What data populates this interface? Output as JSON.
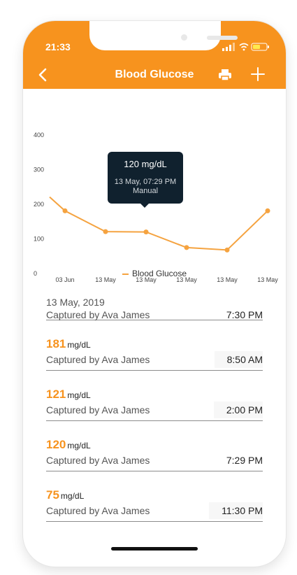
{
  "status_bar": {
    "time": "21:33"
  },
  "nav": {
    "title": "Blood Glucose",
    "icons": [
      "back-chevron-icon",
      "print-icon",
      "plus-icon"
    ]
  },
  "colors": {
    "accent": "#F7931E",
    "line": "#F5A340",
    "tooltip_bg": "#10212e"
  },
  "chart_data": {
    "type": "line",
    "title": "",
    "xlabel": "",
    "ylabel": "",
    "ylim": [
      0,
      400
    ],
    "y_ticks": [
      "0",
      "100",
      "200",
      "300",
      "400"
    ],
    "categories": [
      "03 Jun",
      "13 May",
      "13 May",
      "13 May",
      "13 May",
      "13 May"
    ],
    "series": [
      {
        "name": "Blood Glucose",
        "values": [
          181,
          121,
          120,
          75,
          68,
          181
        ]
      }
    ],
    "legend": "bottom",
    "tooltip": {
      "value": "120 mg/dL",
      "datetime": "13 May, 07:29 PM",
      "source": "Manual"
    }
  },
  "list": {
    "date_header": {
      "date": "13 May, 2019",
      "captured_by": "Captured by Ava James",
      "time": "7:30 PM"
    },
    "readings": [
      {
        "value": "181",
        "unit": "mg/dL",
        "captured_by": "Captured by Ava James",
        "time": "8:50 AM"
      },
      {
        "value": "121",
        "unit": "mg/dL",
        "captured_by": "Captured by Ava James",
        "time": "2:00 PM"
      },
      {
        "value": "120",
        "unit": "mg/dL",
        "captured_by": "Captured by Ava James",
        "time": "7:29 PM"
      },
      {
        "value": "75",
        "unit": "mg/dL",
        "captured_by": "Captured by Ava James",
        "time": "11:30 PM"
      }
    ]
  }
}
